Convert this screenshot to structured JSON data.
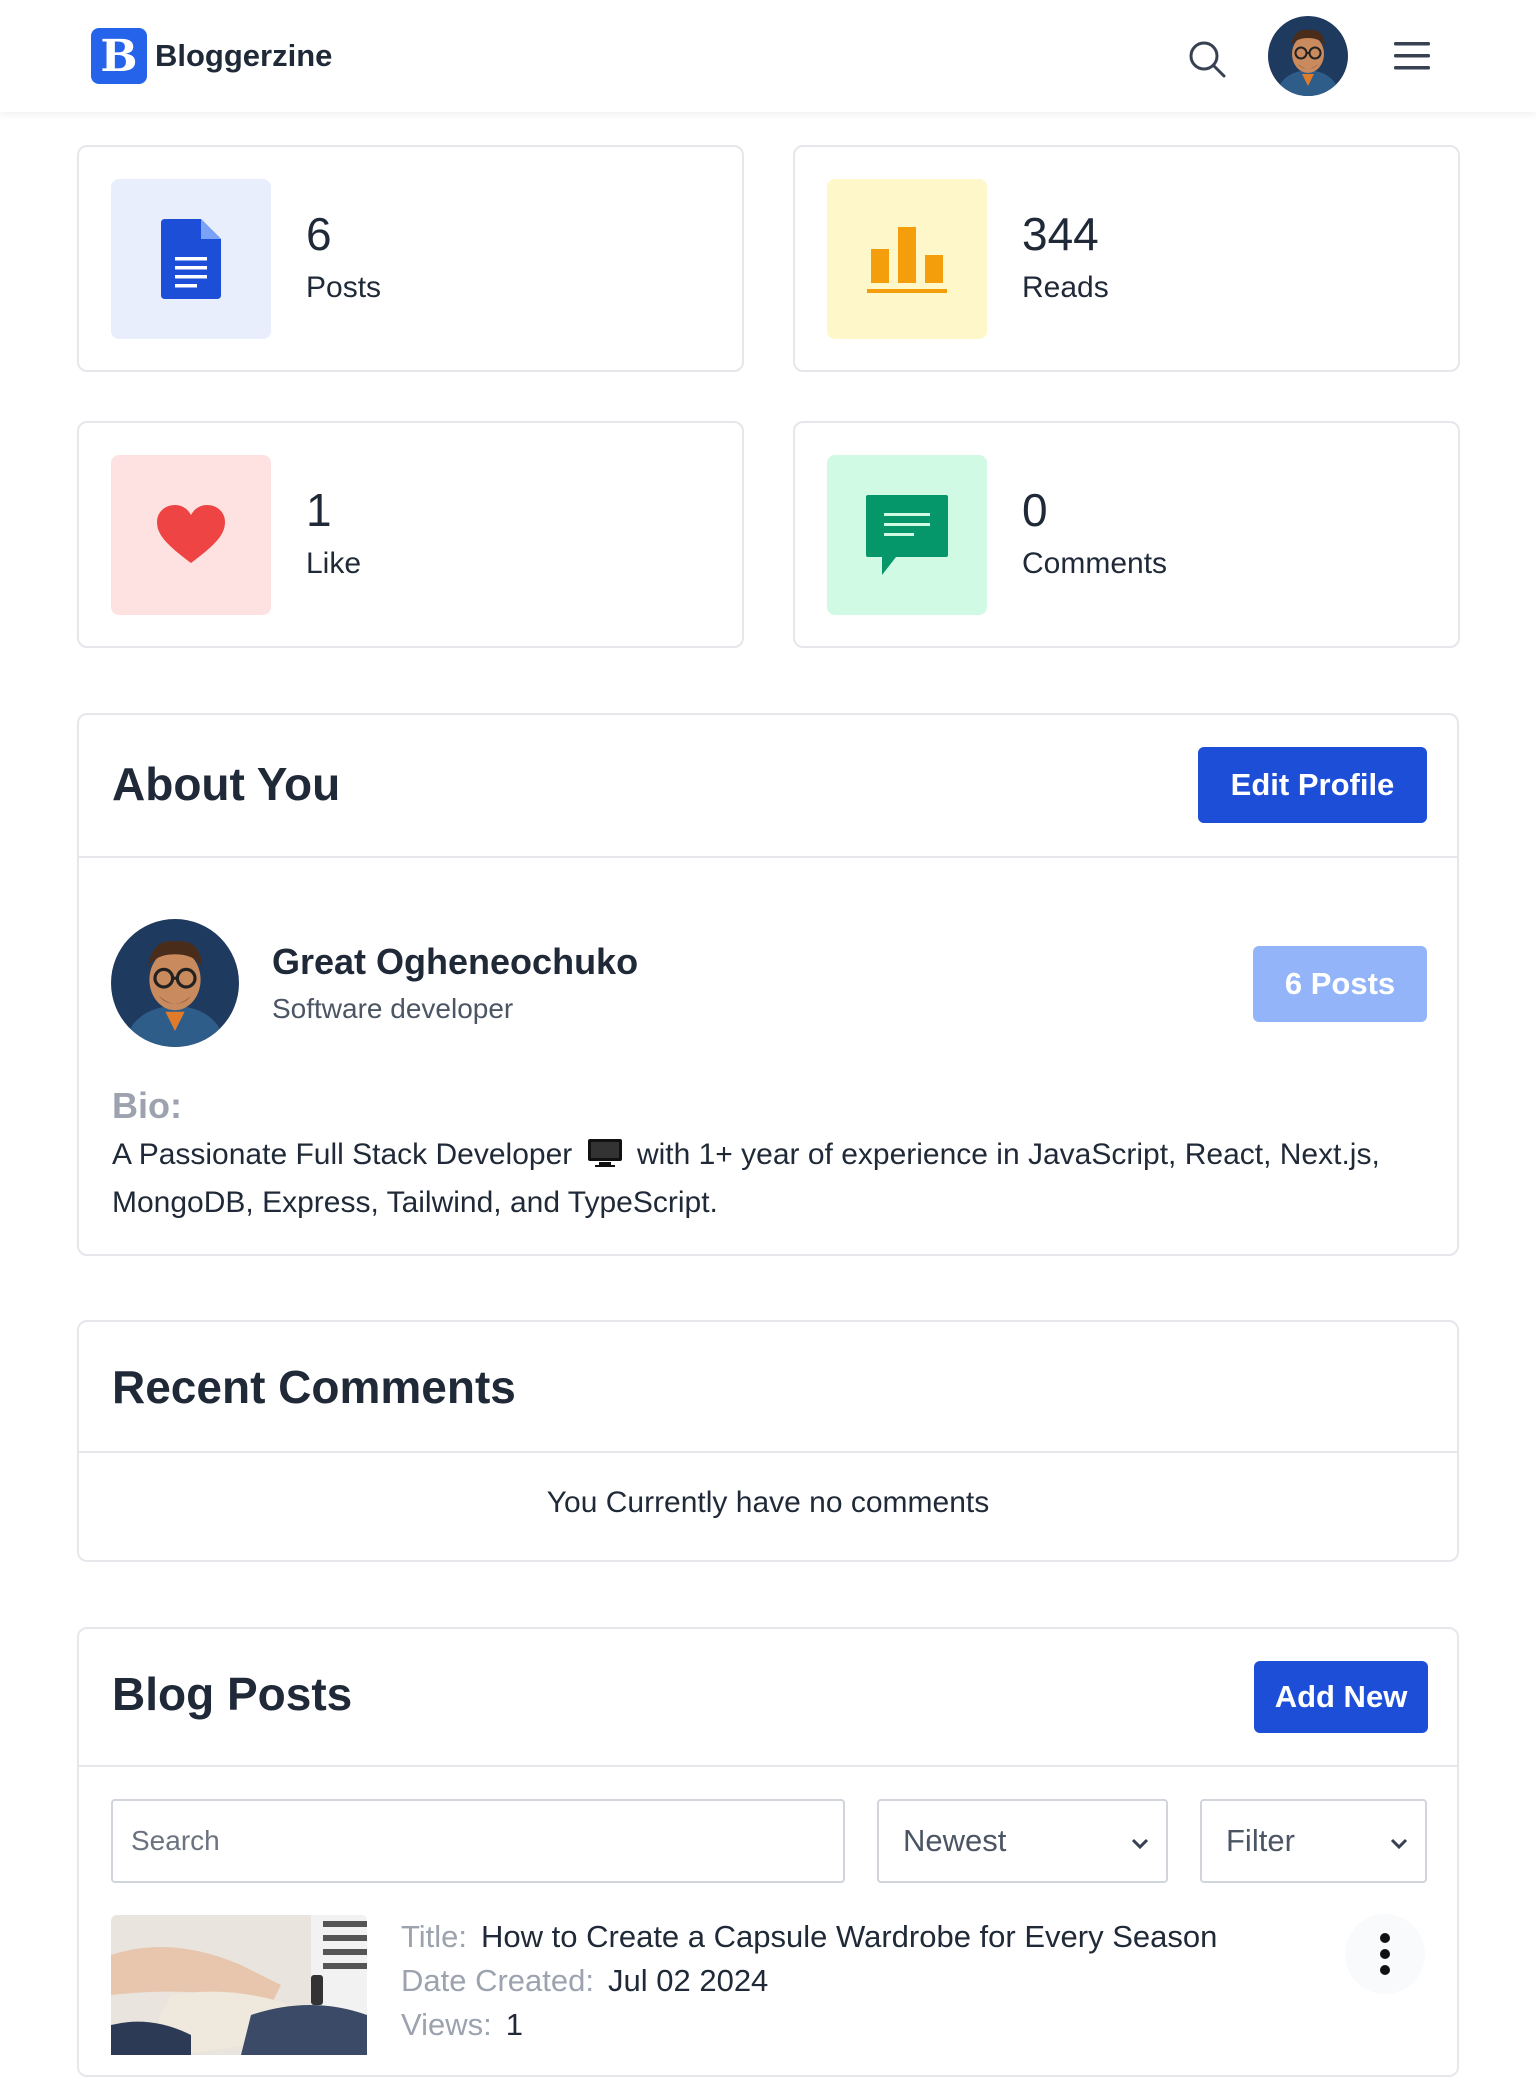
{
  "header": {
    "logo_letter": "B",
    "app_name": "Bloggerzine",
    "icons": {
      "search": "search-icon",
      "avatar": "user-avatar",
      "menu": "hamburger-menu-icon"
    }
  },
  "stats": [
    {
      "value": "6",
      "label": "Posts",
      "icon": "document-icon",
      "bg": "#e8eefc",
      "color": "#1d4ed8"
    },
    {
      "value": "344",
      "label": "Reads",
      "icon": "bar-chart-icon",
      "bg": "#fef7c9",
      "color": "#f59e0b"
    },
    {
      "value": "1",
      "label": "Like",
      "icon": "heart-icon",
      "bg": "#fee2e2",
      "color": "#ef4444"
    },
    {
      "value": "0",
      "label": "Comments",
      "icon": "comment-icon",
      "bg": "#d1fae5",
      "color": "#059669"
    }
  ],
  "about": {
    "title": "About You",
    "edit_button": "Edit Profile",
    "name": "Great Ogheneochuko",
    "role": "Software developer",
    "posts_badge": "6 Posts",
    "bio_label": "Bio:",
    "bio_before_icon": "A Passionate Full Stack Developer",
    "bio_after_icon": "with 1+ year of experience in JavaScript, React, Next.js, MongoDB, Express, Tailwind, and TypeScript."
  },
  "comments": {
    "title": "Recent Comments",
    "empty": "You Currently have no comments"
  },
  "blog": {
    "title": "Blog Posts",
    "add_button": "Add New",
    "search_placeholder": "Search",
    "sort_selected": "Newest",
    "filter_selected": "Filter",
    "posts": [
      {
        "title_key": "Title:",
        "title": "How to Create a Capsule Wardrobe for Every Season",
        "date_key": "Date Created:",
        "date": "Jul 02 2024",
        "views_key": "Views:",
        "views": "1"
      }
    ]
  },
  "colors": {
    "primary": "#1d4ed8",
    "primary_light": "#93b4f8",
    "border": "#e5e7eb",
    "muted_text": "#9ca3af"
  }
}
